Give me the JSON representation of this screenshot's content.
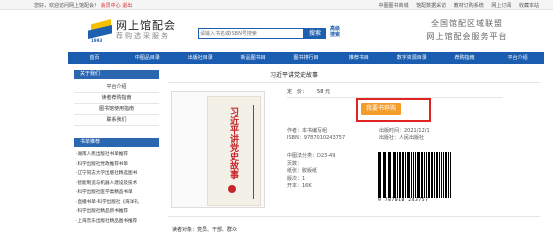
{
  "topbar": {
    "welcome": "您好，欢迎访问网上馆配会！",
    "welcome_red": "会员中心",
    "logout": "退出",
    "links": [
      "中图图书商城",
      "馆配数据采访",
      "教材订购系统",
      "网上订阅",
      "收藏本站"
    ]
  },
  "header": {
    "year": "1993",
    "brand_title": "网上馆配会",
    "brand_sub": "荐购选采服务",
    "search_placeholder": "请输入书名或ISBN号搜索",
    "search_button": "搜索",
    "adv_search_line1": "高级",
    "adv_search_line2": "搜索",
    "right_line1": "全国馆配区域联盟",
    "right_line2": "网上馆配会服务平台"
  },
  "nav": [
    "首页",
    "中图品目录",
    "出版社目录",
    "新品图书目",
    "图书排行目",
    "推荐书目",
    "数字资源目录",
    "荐购指南",
    "平台介绍"
  ],
  "sidebar": {
    "about_head": "关于我们",
    "about_items": [
      "平台介绍",
      "读者荐购指南",
      "图书馆使用指南",
      "联系我们"
    ],
    "rec_head": "书单推荐",
    "rec_items": [
      "·湖南人民出版社书单推荐",
      "·科学出版社党政推荐书单",
      "·辽宁同志大学出版社精选图书",
      "·智能制造与机器人建设及技术",
      "·科学出版社医学类精品书单",
      "·直播书单-科学出版社《海洋礼",
      "·科学出版社精品新书推荐",
      "·上海音乐出版社精品图书推荐"
    ]
  },
  "book": {
    "title": "习近平讲党史故事",
    "cover_title": "习近平讲党史故事",
    "price_label": "定　价：",
    "price_value": "58 元",
    "order_button": "我要书荐购",
    "author": "作者：本书编写组",
    "isbn": "ISBN：9787010243757",
    "pub_date": "出版时间：2021/12/1",
    "version": "版次：1",
    "publisher": "出版社：人民出版社",
    "clc": "中图法分类：D23-49",
    "pages": "页数：",
    "paper": "纸张：胶版纸",
    "binding": "版次：1",
    "format": "开本：16K",
    "barcode_digits": "9 787010 243757",
    "reader_label": "读者对象：党员、干部、群众"
  },
  "colors": {
    "nav_blue": "#1a5db0",
    "order_orange": "#f39c2a",
    "highlight_red": "#e02323"
  }
}
